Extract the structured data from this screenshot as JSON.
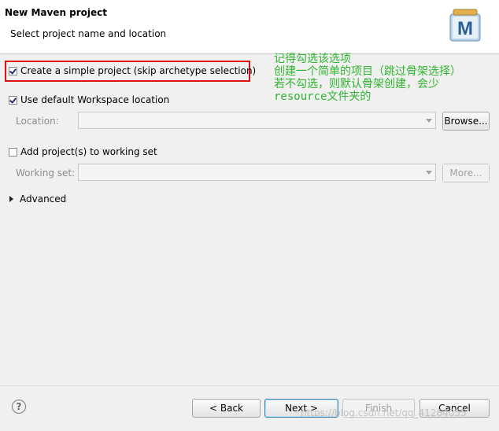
{
  "header": {
    "title": "New Maven project",
    "subtitle": "Select project name and location",
    "logo_letter": "M"
  },
  "options": {
    "simple_project": {
      "label": "Create a simple project (skip archetype selection)",
      "checked": true
    },
    "default_workspace": {
      "label": "Use default Workspace location",
      "checked": true
    },
    "location": {
      "label": "Location:",
      "value": "",
      "browse_label": "Browse..."
    },
    "working_set_check": {
      "label": "Add project(s) to working set",
      "checked": false
    },
    "working_set": {
      "label": "Working set:",
      "value": "",
      "more_label": "More..."
    },
    "advanced_label": "Advanced"
  },
  "annotation": {
    "line1": "记得勾选该选项",
    "line2": "创建一个简单的项目（跳过骨架选择）",
    "line3": "若不勾选，则默认骨架创建，会少",
    "line4": "resource文件夹的"
  },
  "footer": {
    "help_glyph": "?",
    "back_label": "< Back",
    "next_label": "Next >",
    "finish_label": "Finish",
    "cancel_label": "Cancel",
    "watermark": "https://blog.csdn.net/qq_41264055"
  },
  "colors": {
    "highlight_border": "#e01010",
    "annotation_text": "#2fb52f"
  }
}
